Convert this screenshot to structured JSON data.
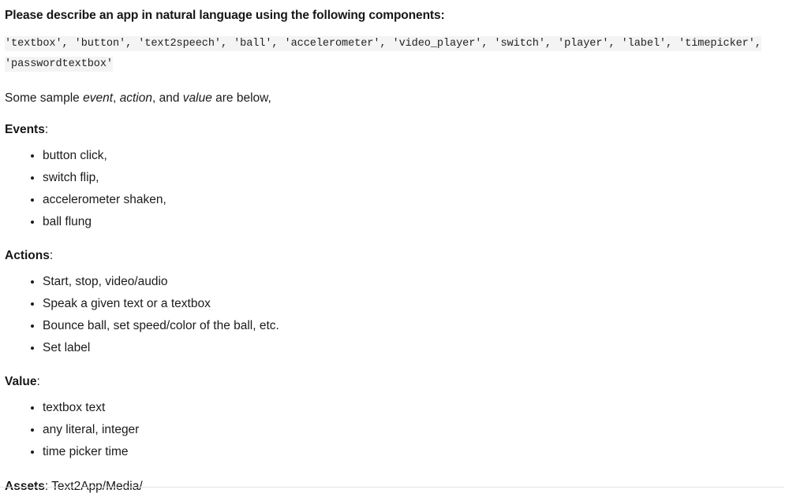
{
  "document": {
    "heading": "Please describe an app in natural language using the following components:",
    "components_code": "'textbox', 'button', 'text2speech', 'ball', 'accelerometer', 'video_player', 'switch', 'player', 'label', 'timepicker', 'passwordtextbox'",
    "intro": {
      "before": "Some sample ",
      "em1": "event",
      "sep1": ", ",
      "em2": "action",
      "sep2": ", and ",
      "em3": "value",
      "after": " are below,"
    },
    "sections": [
      {
        "label": "Events",
        "colon": ":",
        "items": [
          "button click,",
          "switch flip,",
          "accelerometer shaken,",
          "ball flung"
        ]
      },
      {
        "label": "Actions",
        "colon": ":",
        "items": [
          "Start, stop, video/audio",
          "Speak a given text or a textbox",
          "Bounce ball, set speed/color of the ball, etc.",
          "Set label"
        ]
      },
      {
        "label": "Value",
        "colon": ":",
        "items": [
          "textbox text",
          "any literal, integer",
          "time picker time"
        ]
      }
    ],
    "assets": {
      "label": "Assets",
      "value": ": Text2App/Media/"
    },
    "colors": {
      "background": "#ffffff",
      "text": "#1b1b1b",
      "code_background": "#f4f4f4",
      "code_text": "#222222",
      "rule": "#e3e3e3"
    }
  }
}
